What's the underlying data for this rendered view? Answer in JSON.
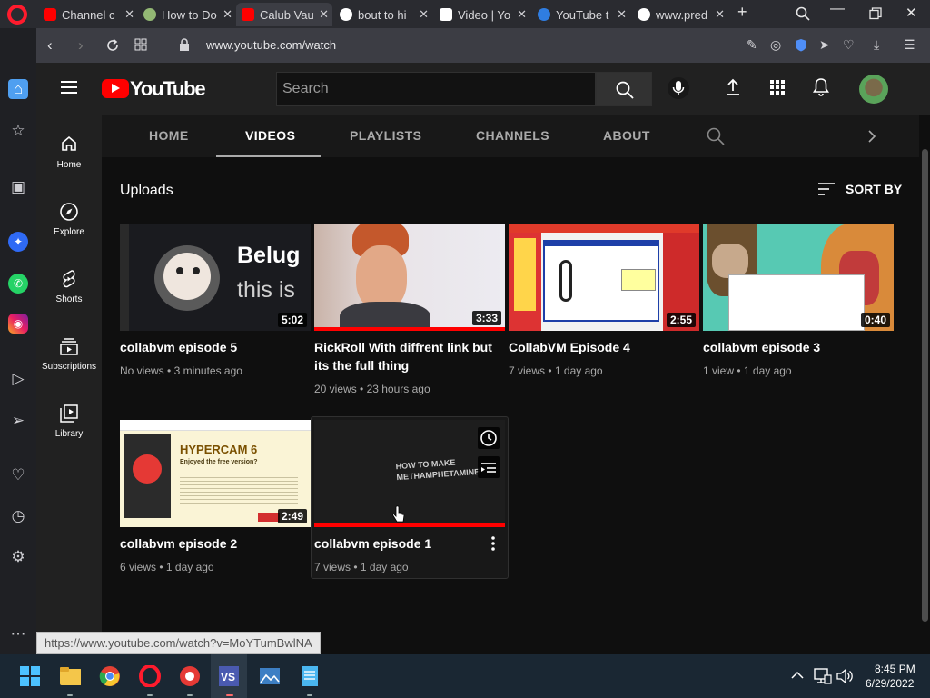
{
  "browser": {
    "tabs": [
      {
        "title": "Channel c",
        "favicon": "youtube-icon",
        "color": "#ff0000"
      },
      {
        "title": "How to Do",
        "favicon": "wikihow-icon",
        "color": "#93b874"
      },
      {
        "title": "Calub Vau",
        "favicon": "youtube-icon",
        "color": "#ff0000"
      },
      {
        "title": "bout to hi",
        "favicon": "google-icon",
        "color": "#ffffff"
      },
      {
        "title": "Video | Yo",
        "favicon": "page-icon",
        "color": "#ffffff"
      },
      {
        "title": "YouTube t",
        "favicon": "info-icon",
        "color": "#2f7de1"
      },
      {
        "title": "www.pred",
        "favicon": "globe-icon",
        "color": "#ffffff"
      }
    ],
    "url": "www.youtube.com/watch",
    "status_url": "https://www.youtube.com/watch?v=MoYTumBwlNA"
  },
  "youtube": {
    "brand": "YouTube",
    "search_placeholder": "Search",
    "guide": [
      {
        "label": "Home",
        "icon": "home-icon"
      },
      {
        "label": "Explore",
        "icon": "compass-icon"
      },
      {
        "label": "Shorts",
        "icon": "shorts-icon"
      },
      {
        "label": "Subscriptions",
        "icon": "subscriptions-icon"
      },
      {
        "label": "Library",
        "icon": "library-icon"
      }
    ],
    "channel_tabs": [
      "HOME",
      "VIDEOS",
      "PLAYLISTS",
      "CHANNELS",
      "ABOUT"
    ],
    "active_tab": "VIDEOS",
    "section_title": "Uploads",
    "sort_label": "SORT BY",
    "videos": [
      {
        "title": "collabvm episode 5",
        "duration": "5:02",
        "views": "No views",
        "age": "3 minutes ago",
        "progress": 0,
        "thumb_text": "Belug\nthis is"
      },
      {
        "title": "RickRoll With diffrent link but its the full thing",
        "duration": "3:33",
        "views": "20 views",
        "age": "23 hours ago",
        "progress": 1
      },
      {
        "title": "CollabVM Episode 4",
        "duration": "2:55",
        "views": "7 views",
        "age": "1 day ago",
        "progress": 0
      },
      {
        "title": "collabvm episode 3",
        "duration": "0:40",
        "views": "1 view",
        "age": "1 day ago",
        "progress": 0
      },
      {
        "title": "collabvm episode 2",
        "duration": "2:49",
        "views": "6 views",
        "age": "1 day ago",
        "progress": 0,
        "thumb_heading": "HYPERCAM 6",
        "thumb_sub": "Enjoyed the free version?"
      },
      {
        "title": "collabvm episode 1",
        "duration": "",
        "views": "7 views",
        "age": "1 day ago",
        "progress": 1,
        "thumb_text": "HOW TO MAKE\nMETHAMPHETAMINE"
      }
    ]
  },
  "taskbar": {
    "time": "8:45 PM",
    "date": "6/29/2022"
  }
}
